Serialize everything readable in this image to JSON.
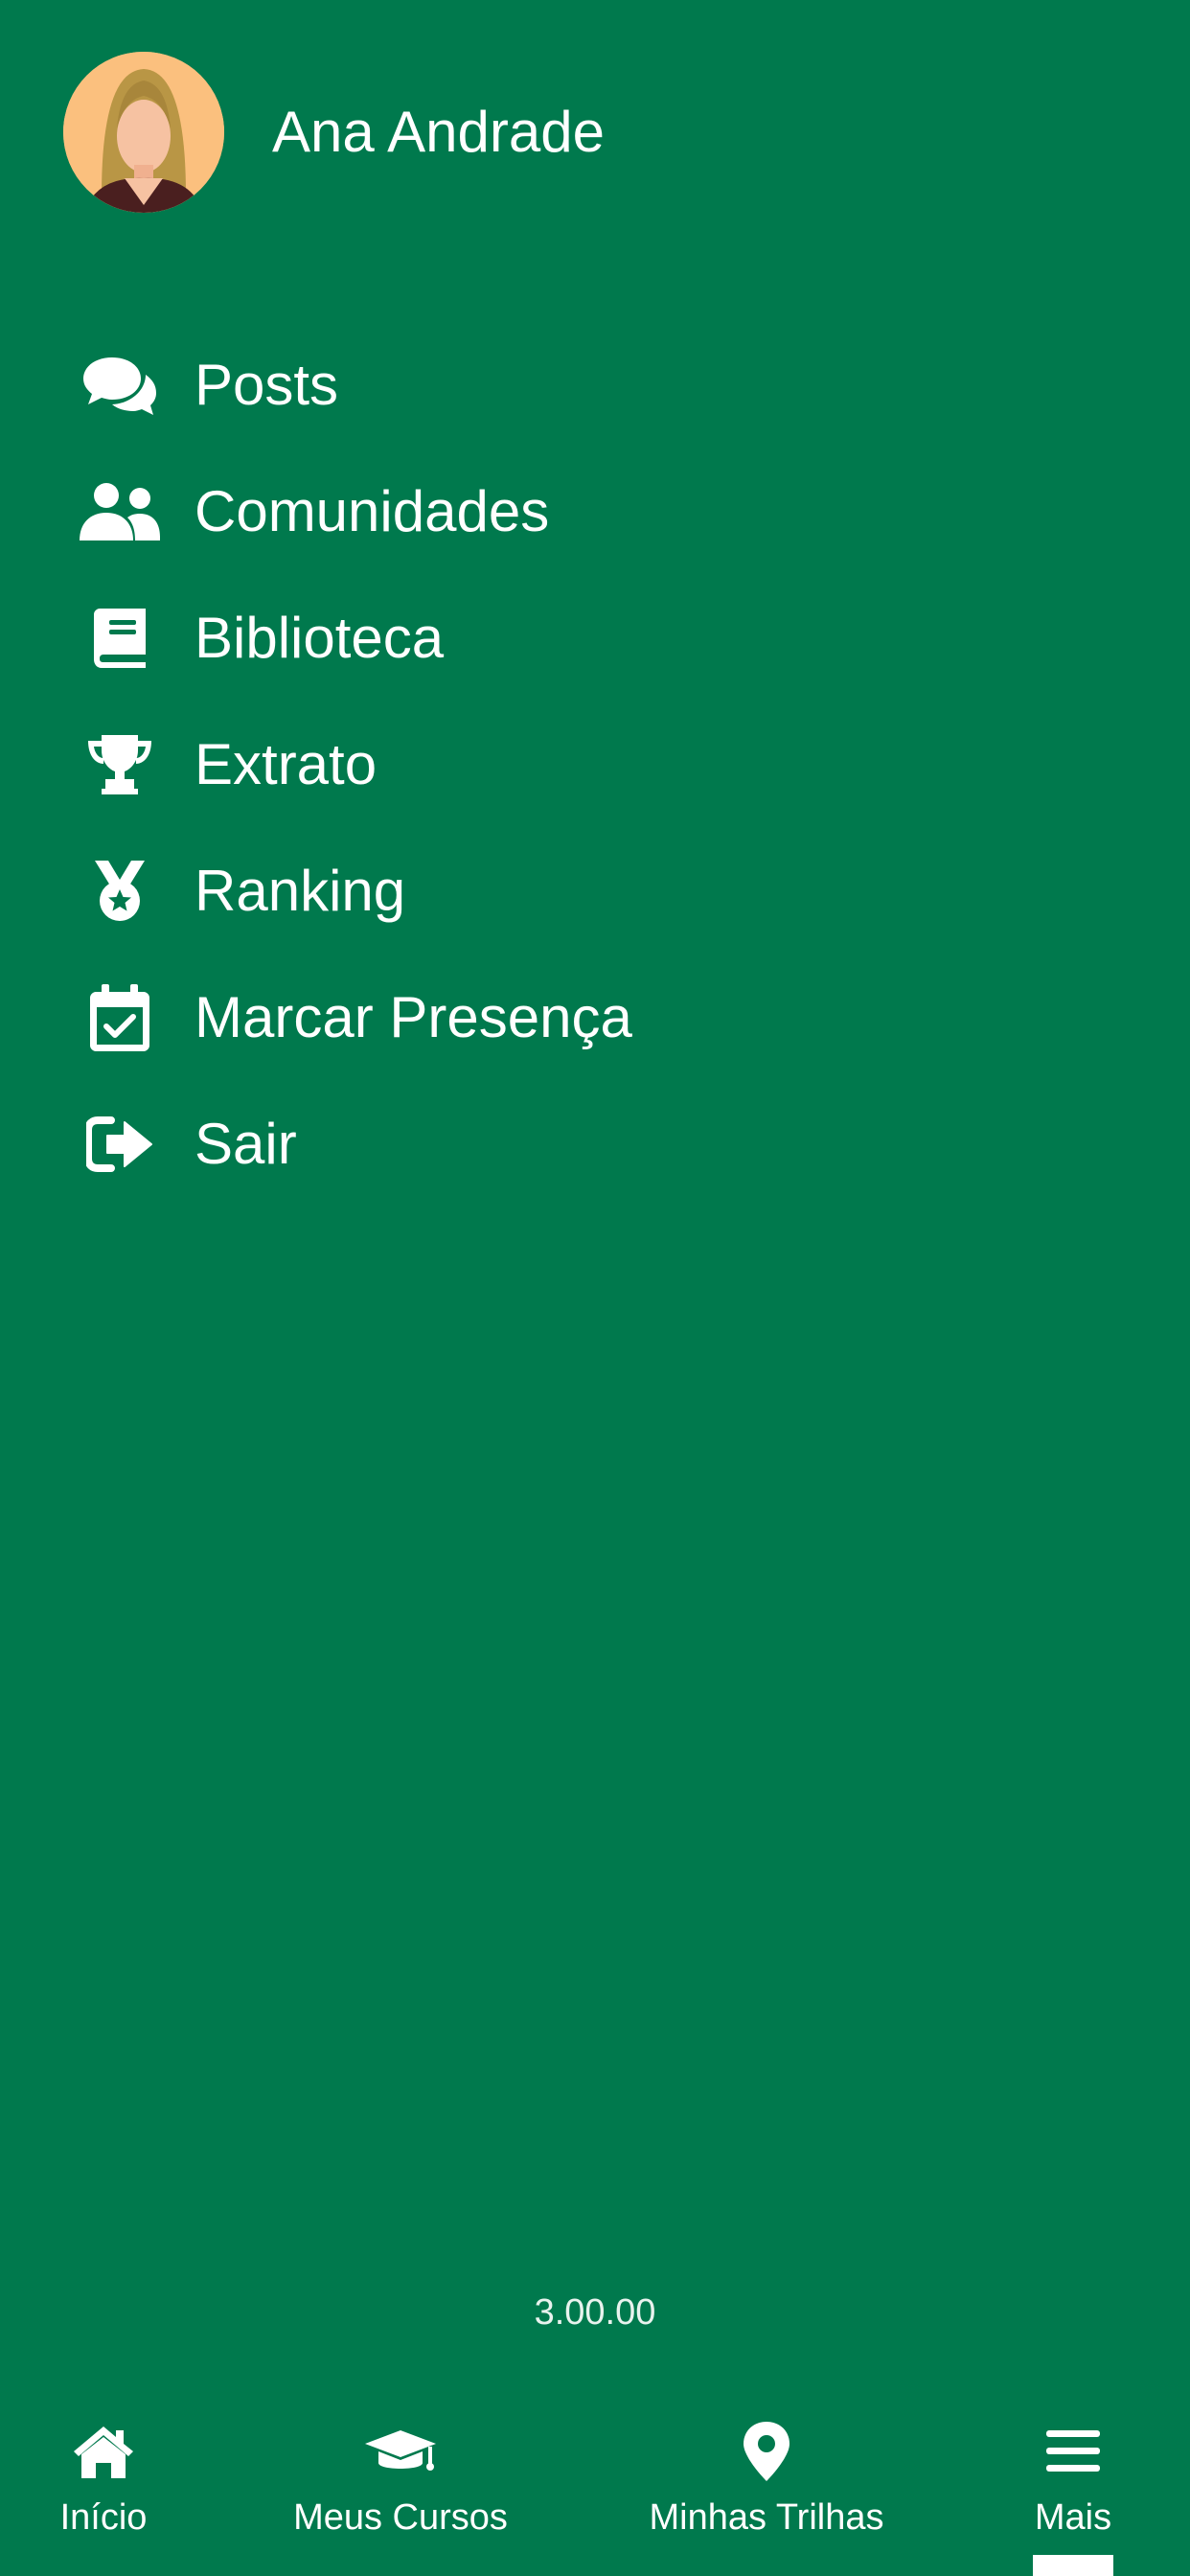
{
  "user": {
    "name": "Ana Andrade",
    "avatar_icon": "female-avatar"
  },
  "menu": [
    {
      "label": "Posts",
      "icon": "comments-icon"
    },
    {
      "label": "Comunidades",
      "icon": "users-icon"
    },
    {
      "label": "Biblioteca",
      "icon": "book-icon"
    },
    {
      "label": "Extrato",
      "icon": "trophy-icon"
    },
    {
      "label": "Ranking",
      "icon": "medal-icon"
    },
    {
      "label": "Marcar Presença",
      "icon": "calendar-check-icon"
    },
    {
      "label": "Sair",
      "icon": "sign-out-icon"
    }
  ],
  "version": "3.00.00",
  "bottom_nav": {
    "items": [
      {
        "label": "Início",
        "icon": "home-icon"
      },
      {
        "label": "Meus Cursos",
        "icon": "graduation-cap-icon"
      },
      {
        "label": "Minhas Trilhas",
        "icon": "map-marker-icon"
      },
      {
        "label": "Mais",
        "icon": "menu-bars-icon",
        "active": true
      }
    ]
  },
  "colors": {
    "background": "#00794d",
    "foreground": "#ffffff",
    "avatar_bg": "#fbc07e"
  }
}
